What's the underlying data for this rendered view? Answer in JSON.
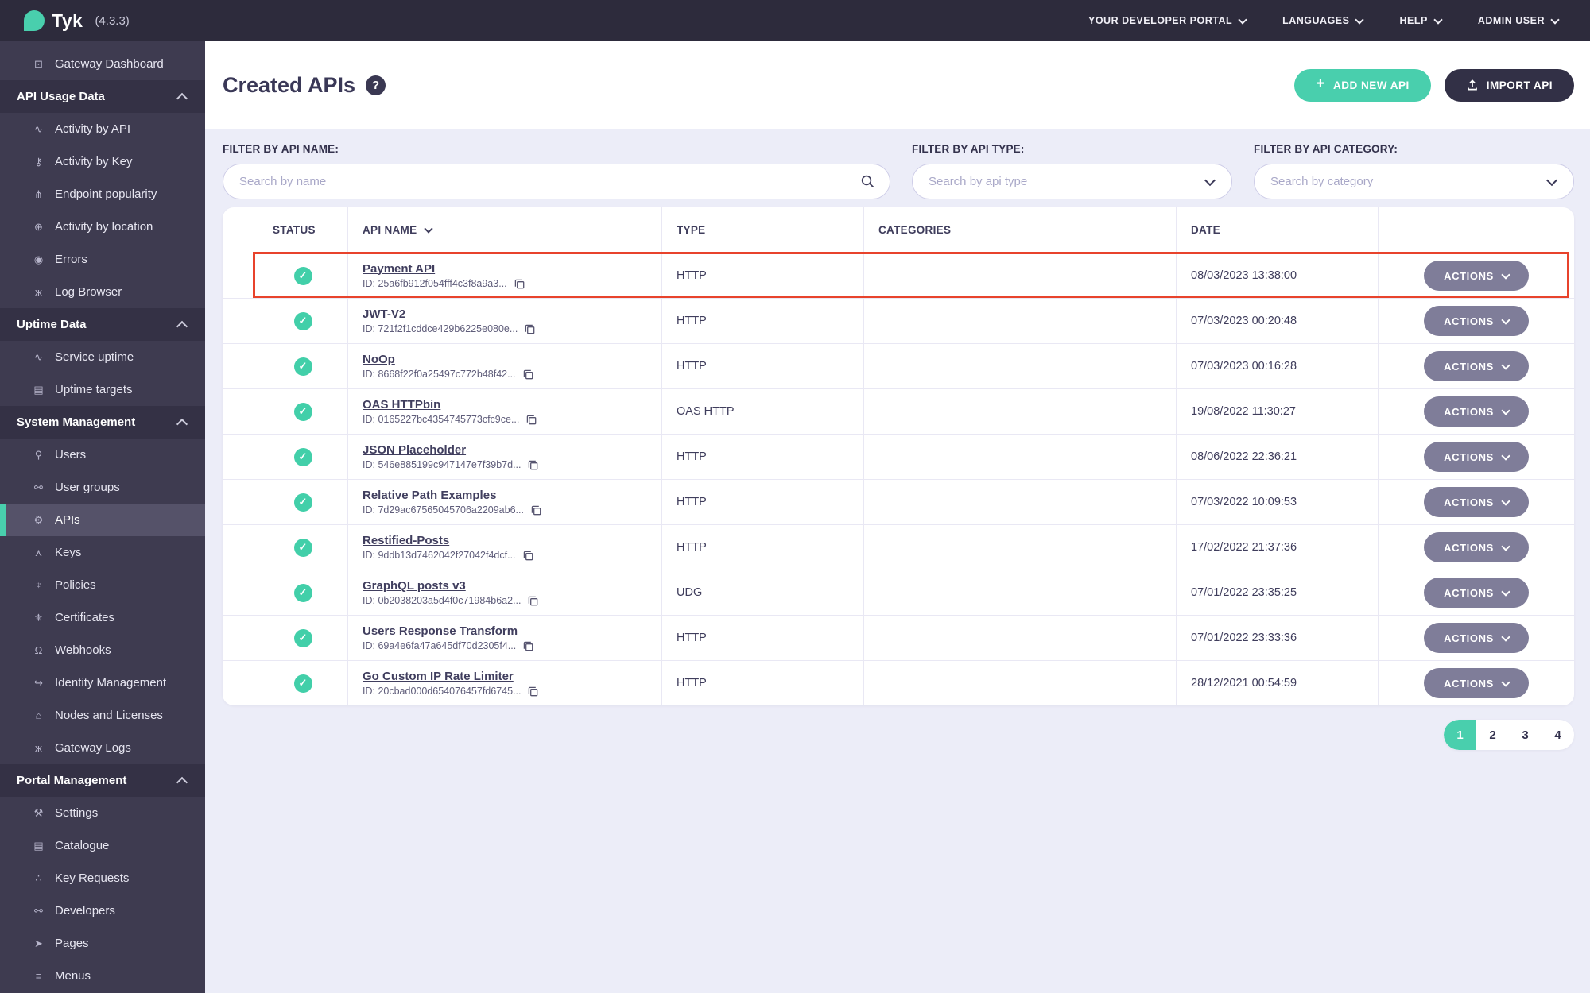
{
  "topbar": {
    "brand": "Tyk",
    "version": "(4.3.3)",
    "menus": [
      {
        "label": "YOUR DEVELOPER PORTAL"
      },
      {
        "label": "LANGUAGES"
      },
      {
        "label": "HELP"
      },
      {
        "label": "ADMIN USER"
      }
    ]
  },
  "icons": {
    "monitor": "⊡",
    "pulse": "∿",
    "key": "⚷",
    "branch": "⋔",
    "globe": "⊕",
    "error": "◉",
    "bug": "ж",
    "list": "▤",
    "user": "⚲",
    "users": "⚯",
    "gears": "⚙",
    "sitemap": "⋏",
    "policy": "♆",
    "certificate": "⚜",
    "bell": "Ω",
    "identity": "↪",
    "bank": "⌂",
    "wrench": "⚒",
    "paw": "∴",
    "page": "➤",
    "menu": "≡",
    "check": "✓",
    "question": "?",
    "plus": "+"
  },
  "sidebar": {
    "items": [
      {
        "kind": "link",
        "icon": "monitor",
        "label": "Gateway Dashboard"
      },
      {
        "kind": "section",
        "label": "API Usage Data"
      },
      {
        "kind": "link",
        "icon": "pulse",
        "label": "Activity by API"
      },
      {
        "kind": "link",
        "icon": "key",
        "label": "Activity by Key"
      },
      {
        "kind": "link",
        "icon": "branch",
        "label": "Endpoint popularity"
      },
      {
        "kind": "link",
        "icon": "globe",
        "label": "Activity by location"
      },
      {
        "kind": "link",
        "icon": "error",
        "label": "Errors"
      },
      {
        "kind": "link",
        "icon": "bug",
        "label": "Log Browser"
      },
      {
        "kind": "section",
        "label": "Uptime Data"
      },
      {
        "kind": "link",
        "icon": "pulse",
        "label": "Service uptime"
      },
      {
        "kind": "link",
        "icon": "list",
        "label": "Uptime targets"
      },
      {
        "kind": "section",
        "label": "System Management"
      },
      {
        "kind": "link",
        "icon": "user",
        "label": "Users"
      },
      {
        "kind": "link",
        "icon": "users",
        "label": "User groups"
      },
      {
        "kind": "link",
        "icon": "gears",
        "label": "APIs",
        "active": true
      },
      {
        "kind": "link",
        "icon": "sitemap",
        "label": "Keys"
      },
      {
        "kind": "link",
        "icon": "policy",
        "label": "Policies"
      },
      {
        "kind": "link",
        "icon": "certificate",
        "label": "Certificates"
      },
      {
        "kind": "link",
        "icon": "bell",
        "label": "Webhooks"
      },
      {
        "kind": "link",
        "icon": "identity",
        "label": "Identity Management"
      },
      {
        "kind": "link",
        "icon": "bank",
        "label": "Nodes and Licenses"
      },
      {
        "kind": "link",
        "icon": "bug",
        "label": "Gateway Logs"
      },
      {
        "kind": "section",
        "label": "Portal Management"
      },
      {
        "kind": "link",
        "icon": "wrench",
        "label": "Settings"
      },
      {
        "kind": "link",
        "icon": "list",
        "label": "Catalogue"
      },
      {
        "kind": "link",
        "icon": "paw",
        "label": "Key Requests"
      },
      {
        "kind": "link",
        "icon": "users",
        "label": "Developers"
      },
      {
        "kind": "link",
        "icon": "page",
        "label": "Pages"
      },
      {
        "kind": "link",
        "icon": "menu",
        "label": "Menus"
      }
    ]
  },
  "page": {
    "title": "Created APIs",
    "add_button": "ADD NEW API",
    "import_button": "IMPORT API"
  },
  "filters": [
    {
      "label": "FILTER BY API NAME:",
      "placeholder": "Search by name",
      "kind": "search"
    },
    {
      "label": "FILTER BY API TYPE:",
      "placeholder": "Search by api type",
      "kind": "select"
    },
    {
      "label": "FILTER BY API CATEGORY:",
      "placeholder": "Search by category",
      "kind": "select"
    }
  ],
  "table": {
    "columns": [
      "STATUS",
      "API NAME",
      "TYPE",
      "CATEGORIES",
      "DATE"
    ],
    "id_prefix": "ID: ",
    "actions_label": "ACTIONS",
    "rows": [
      {
        "name": "Payment API",
        "id": "25a6fb912f054fff4c3f8a9a3...",
        "type": "HTTP",
        "category": "",
        "date": "08/03/2023 13:38:00",
        "status": "active"
      },
      {
        "name": "JWT-V2",
        "id": "721f2f1cddce429b6225e080e...",
        "type": "HTTP",
        "category": "",
        "date": "07/03/2023 00:20:48",
        "status": "active"
      },
      {
        "name": "NoOp",
        "id": "8668f22f0a25497c772b48f42...",
        "type": "HTTP",
        "category": "",
        "date": "07/03/2023 00:16:28",
        "status": "active"
      },
      {
        "name": "OAS HTTPbin",
        "id": "0165227bc4354745773cfc9ce...",
        "type": "OAS HTTP",
        "category": "",
        "date": "19/08/2022 11:30:27",
        "status": "active"
      },
      {
        "name": "JSON Placeholder",
        "id": "546e885199c947147e7f39b7d...",
        "type": "HTTP",
        "category": "",
        "date": "08/06/2022 22:36:21",
        "status": "active"
      },
      {
        "name": "Relative Path Examples",
        "id": "7d29ac67565045706a2209ab6...",
        "type": "HTTP",
        "category": "",
        "date": "07/03/2022 10:09:53",
        "status": "active"
      },
      {
        "name": "Restified-Posts",
        "id": "9ddb13d7462042f27042f4dcf...",
        "type": "HTTP",
        "category": "",
        "date": "17/02/2022 21:37:36",
        "status": "active"
      },
      {
        "name": "GraphQL posts v3",
        "id": "0b2038203a5d4f0c71984b6a2...",
        "type": "UDG",
        "category": "",
        "date": "07/01/2022 23:35:25",
        "status": "active"
      },
      {
        "name": "Users Response Transform",
        "id": "69a4e6fa47a645df70d2305f4...",
        "type": "HTTP",
        "category": "",
        "date": "07/01/2022 23:33:36",
        "status": "active"
      },
      {
        "name": "Go Custom IP Rate Limiter",
        "id": "20cbad000d654076457fd6745...",
        "type": "HTTP",
        "category": "",
        "date": "28/12/2021 00:54:59",
        "status": "active"
      }
    ]
  },
  "pagination": {
    "pages": [
      "1",
      "2",
      "3",
      "4"
    ],
    "active": "1"
  },
  "highlight": {
    "row_index": 0,
    "color": "#e8432c"
  },
  "colors": {
    "accent_teal": "#49cfad",
    "topbar_dark": "#2d2b3c",
    "sidebar": "#3e3b50",
    "highlight_red": "#e8432c",
    "actions_gray": "#7f7d99",
    "page_bg": "#ecedf8"
  }
}
